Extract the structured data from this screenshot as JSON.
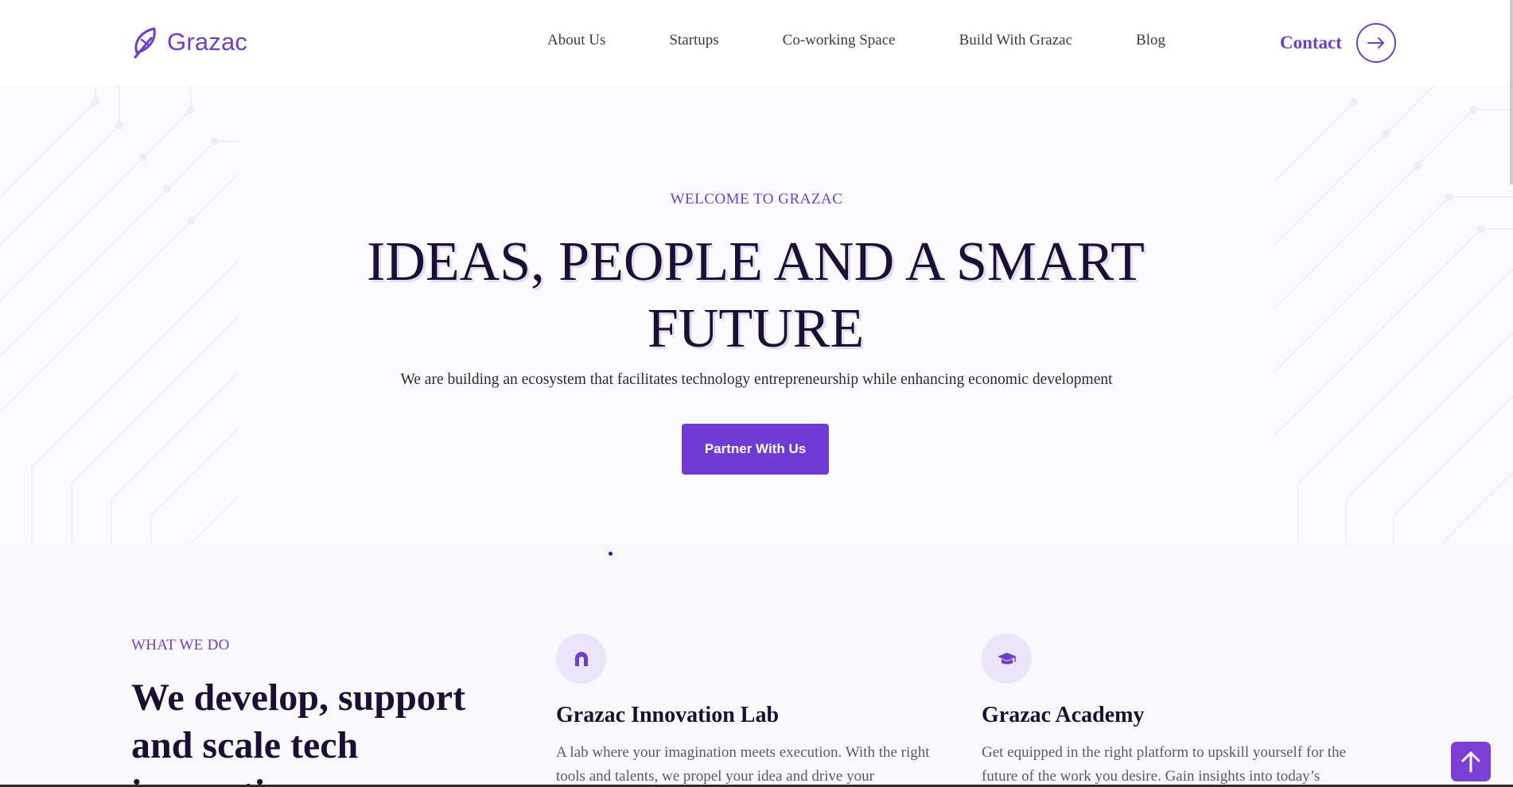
{
  "brand": {
    "name": "Grazac",
    "color": "#6f3fc9"
  },
  "nav": {
    "items": [
      {
        "label": "About Us"
      },
      {
        "label": "Startups"
      },
      {
        "label": "Co-working Space"
      },
      {
        "label": "Build With Grazac"
      },
      {
        "label": "Blog"
      }
    ],
    "contact_label": "Contact",
    "contact_icon": "arrow-right-icon"
  },
  "hero": {
    "eyebrow": "WELCOME TO GRAZAC",
    "title": "IDEAS, PEOPLE AND A SMART FUTURE",
    "subtitle": "We are building an ecosystem that facilitates technology entrepreneurship while enhancing economic development",
    "cta_label": "Partner With Us",
    "cta_color": "#6f3bd3"
  },
  "what_we_do": {
    "eyebrow": "WHAT WE DO",
    "heading": "We develop, support and scale tech innovations",
    "cards": [
      {
        "icon": "arch-icon",
        "title": "Grazac Innovation Lab",
        "text": "A lab where your imagination meets execution. With the right tools and talents, we propel your idea and drive your"
      },
      {
        "icon": "graduation-cap-icon",
        "title": "Grazac Academy",
        "text": "Get equipped in the right platform to upskill yourself for the future of the work you desire. Gain insights into today’s"
      }
    ]
  },
  "scroll_top_icon": "arrow-up-icon"
}
